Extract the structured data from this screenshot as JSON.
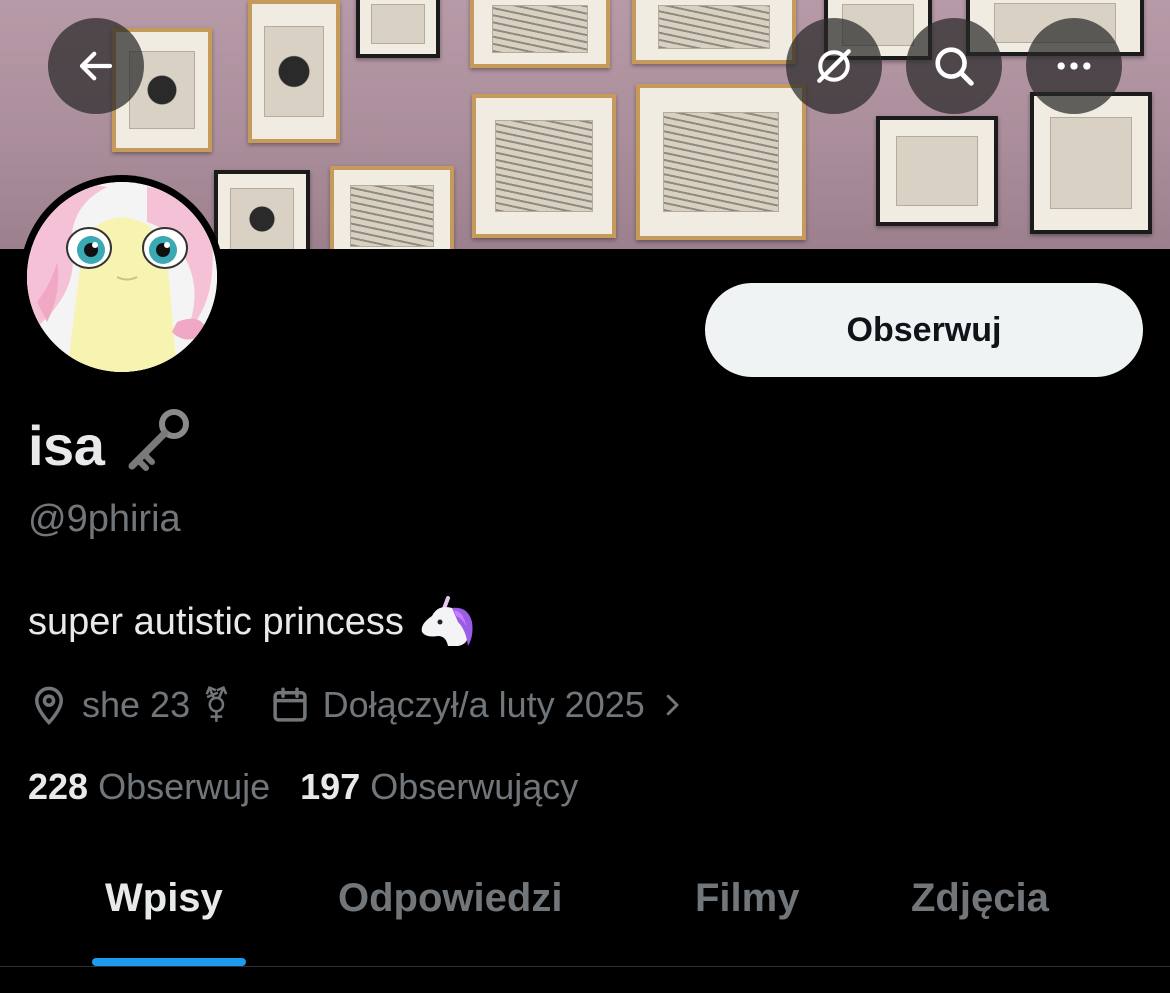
{
  "header": {
    "back_icon": "arrow-left-icon",
    "grok_icon": "grok-icon",
    "search_icon": "search-icon",
    "more_icon": "more-horizontal-icon"
  },
  "profile": {
    "name": "isa",
    "name_emoji": "🗝",
    "handle": "@9phiria",
    "bio": "super autistic princess",
    "bio_emoji": "🦄",
    "location_icon": "location-pin-icon",
    "location": "she 23",
    "location_symbol": "⚧",
    "calendar_icon": "calendar-icon",
    "joined": "Dołączył/a luty 2025"
  },
  "follow_button": {
    "label": "Obserwuj"
  },
  "stats": {
    "following_count": "228",
    "following_label": "Obserwuje",
    "followers_count": "197",
    "followers_label": "Obserwujący"
  },
  "tabs": [
    {
      "label": "Wpisy",
      "active": true
    },
    {
      "label": "Odpowiedzi",
      "active": false
    },
    {
      "label": "Filmy",
      "active": false
    },
    {
      "label": "Zdjęcia",
      "active": false
    }
  ],
  "colors": {
    "background": "#000000",
    "text_primary": "#e7e9ea",
    "text_secondary": "#71767b",
    "accent": "#1d9bf0",
    "follow_button_bg": "#eff3f4",
    "follow_button_text": "#0f1419"
  }
}
